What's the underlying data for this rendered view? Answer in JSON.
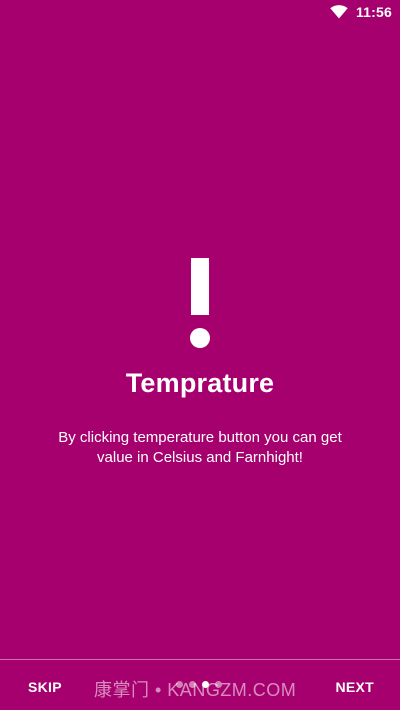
{
  "status_bar": {
    "time": "11:56",
    "icons": [
      "wifi-icon"
    ]
  },
  "slide": {
    "icon": "exclamation-icon",
    "title": "Temprature",
    "description": "By clicking temperature button you can get value in Celsius and Farnhight!",
    "background_color": "#a6006e"
  },
  "navigation": {
    "skip_label": "SKIP",
    "next_label": "NEXT",
    "page_count": 4,
    "active_page_index": 2
  },
  "watermark": {
    "text": "康掌门 • KANGZM.COM"
  }
}
